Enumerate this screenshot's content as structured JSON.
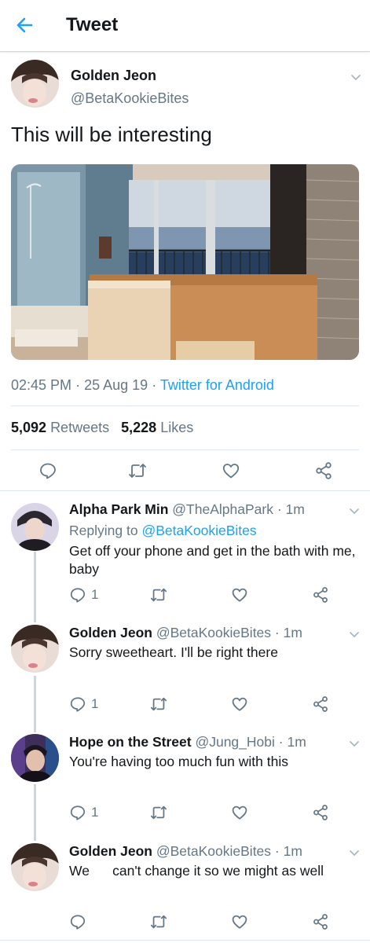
{
  "header": {
    "title": "Tweet",
    "back_icon": "arrow-left-icon",
    "accent": "#1da1f2"
  },
  "tweet": {
    "author_name": "Golden Jeon",
    "author_handle": "@BetaKookieBites",
    "text": "This will be interesting",
    "media_alt": "bathroom with wooden bathtub and ocean view",
    "time": "02:45 PM",
    "date": "25 Aug 19",
    "source": "Twitter for Android",
    "retweets_count": "5,092",
    "retweets_label": "Retweets",
    "likes_count": "5,228",
    "likes_label": "Likes",
    "dot": "·"
  },
  "replies": [
    {
      "name": "Alpha Park Min",
      "handle": "@TheAlphaPark",
      "time": "1m",
      "replying_prefix": "Replying to",
      "replying_to": "@BetaKookieBites",
      "text": "Get off your phone and get in the bath with me, baby",
      "reply_count": "1"
    },
    {
      "name": "Golden Jeon",
      "handle": "@BetaKookieBites",
      "time": "1m",
      "text": "Sorry sweetheart. I'll be right there",
      "reply_count": "1"
    },
    {
      "name": "Hope on the Street",
      "handle": "@Jung_Hobi",
      "time": "1m",
      "text": "You're having too much fun with this",
      "reply_count": "1"
    },
    {
      "name": "Golden Jeon",
      "handle": "@BetaKookieBites",
      "time": "1m",
      "text": "We      can't change it so we might as well",
      "reply_count": ""
    }
  ]
}
